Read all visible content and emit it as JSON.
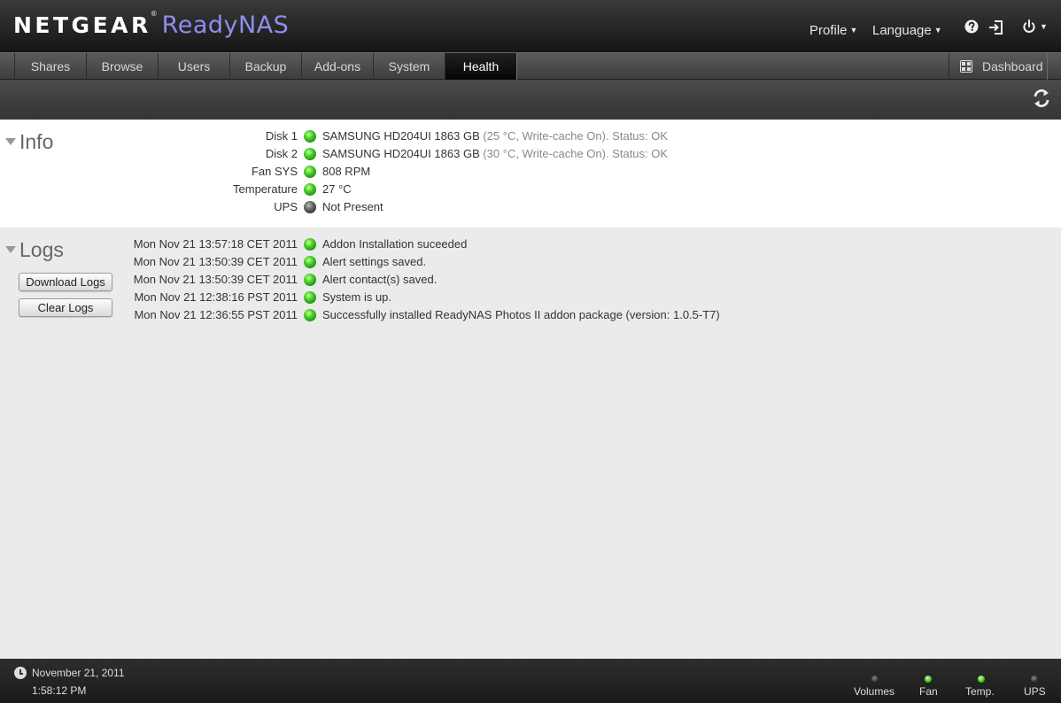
{
  "header": {
    "brand_primary": "NETGEAR",
    "brand_reg": "®",
    "brand_product": "ReadyNAS",
    "profile_label": "Profile",
    "language_label": "Language"
  },
  "tabs": [
    {
      "label": "Shares"
    },
    {
      "label": "Browse"
    },
    {
      "label": "Users"
    },
    {
      "label": "Backup"
    },
    {
      "label": "Add-ons"
    },
    {
      "label": "System"
    },
    {
      "label": "Health",
      "active": true
    }
  ],
  "dashboard_label": "Dashboard",
  "info": {
    "title": "Info",
    "rows": [
      {
        "label": "Disk 1",
        "status": "green",
        "value": "SAMSUNG HD204UI 1863 GB",
        "detail": " (25 °C, Write-cache On). Status: OK"
      },
      {
        "label": "Disk 2",
        "status": "green",
        "value": "SAMSUNG HD204UI 1863 GB",
        "detail": " (30 °C, Write-cache On). Status: OK"
      },
      {
        "label": "Fan SYS",
        "status": "green",
        "value": "808 RPM",
        "detail": ""
      },
      {
        "label": "Temperature",
        "status": "green",
        "value": "27 °C",
        "detail": ""
      },
      {
        "label": "UPS",
        "status": "gray",
        "value": "Not Present",
        "detail": ""
      }
    ]
  },
  "logs": {
    "title": "Logs",
    "download_label": "Download Logs",
    "clear_label": "Clear Logs",
    "entries": [
      {
        "time": "Mon Nov 21 13:57:18 CET 2011",
        "status": "green",
        "message": "Addon Installation suceeded"
      },
      {
        "time": "Mon Nov 21 13:50:39 CET 2011",
        "status": "green",
        "message": "Alert settings saved."
      },
      {
        "time": "Mon Nov 21 13:50:39 CET 2011",
        "status": "green",
        "message": "Alert contact(s) saved."
      },
      {
        "time": "Mon Nov 21 12:38:16 PST 2011",
        "status": "green",
        "message": "System is up."
      },
      {
        "time": "Mon Nov 21 12:36:55 PST 2011",
        "status": "green",
        "message": "Successfully installed ReadyNAS Photos II addon package (version: 1.0.5-T7)"
      }
    ]
  },
  "footer": {
    "date": "November 21, 2011",
    "time": "1:58:12 PM",
    "indicators": [
      {
        "label": "Volumes",
        "status": "dark"
      },
      {
        "label": "Fan",
        "status": "green"
      },
      {
        "label": "Temp.",
        "status": "green"
      },
      {
        "label": "UPS",
        "status": "dark"
      }
    ]
  },
  "colors": {
    "status_green": "#3fc01f",
    "status_gray": "#555555",
    "brand_purple": "#8e8ef0",
    "header_dark": "#1a1a1a"
  }
}
